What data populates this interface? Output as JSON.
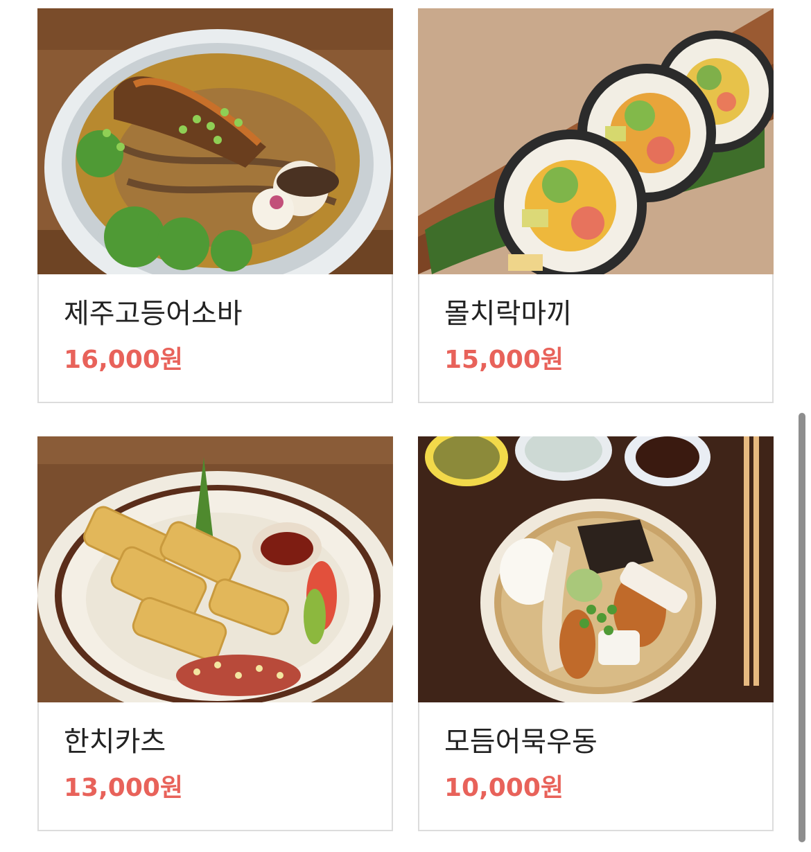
{
  "menu": {
    "items": [
      {
        "name": "제주고등어소바",
        "price": "16,000원",
        "photo_icon": "soba-bowl-photo"
      },
      {
        "name": "몰치락마끼",
        "price": "15,000원",
        "photo_icon": "maki-roll-photo"
      },
      {
        "name": "한치카츠",
        "price": "13,000원",
        "photo_icon": "squid-katsu-photo"
      },
      {
        "name": "모듬어묵우동",
        "price": "10,000원",
        "photo_icon": "udon-bowl-photo"
      }
    ]
  },
  "colors": {
    "price": "#e8625a",
    "name": "#222222",
    "card_border": "#dcdcdc",
    "scrollbar": "#8e8e8e"
  }
}
